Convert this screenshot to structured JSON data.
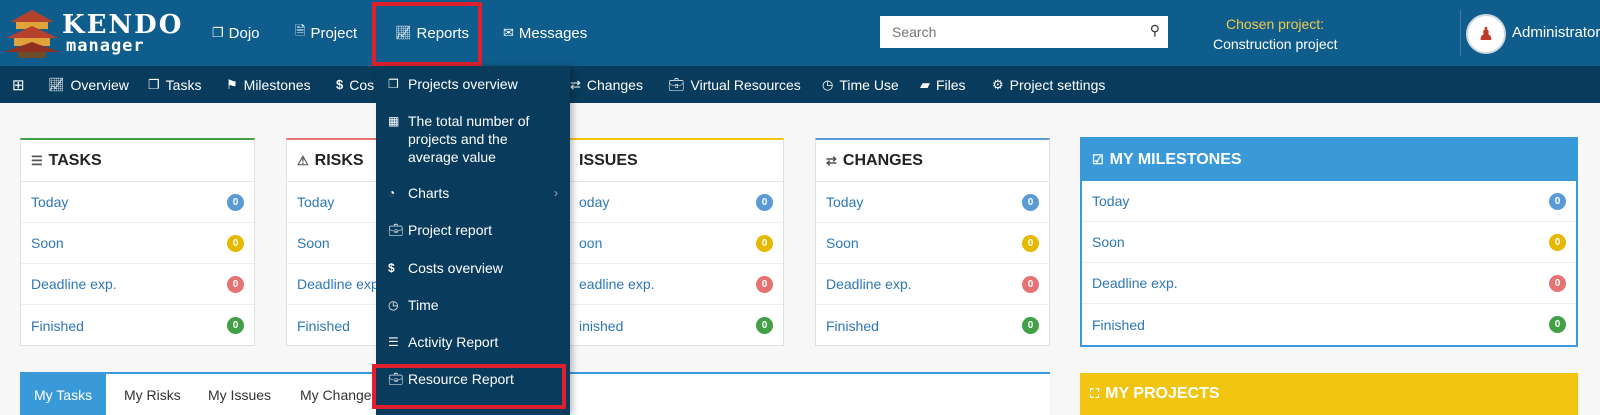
{
  "brand": {
    "line1": "KENDO",
    "line2": "manager"
  },
  "topnav": {
    "items": [
      {
        "icon": "copy-icon",
        "label": "Dojo"
      },
      {
        "icon": "file-icon",
        "label": "Project"
      },
      {
        "icon": "chart-line-icon",
        "label": "Reports"
      },
      {
        "icon": "envelope-icon",
        "label": "Messages"
      }
    ]
  },
  "search": {
    "placeholder": "Search",
    "value": ""
  },
  "chosen_project": {
    "label": "Chosen project:",
    "value": "Construction project"
  },
  "user": {
    "name": "Administrator"
  },
  "subnav": {
    "items": [
      {
        "label": "Overview"
      },
      {
        "label": "Tasks"
      },
      {
        "label": "Milestones"
      },
      {
        "label": "Cos"
      },
      {
        "label": "Changes"
      },
      {
        "label": "Virtual Resources"
      },
      {
        "label": "Time Use"
      },
      {
        "label": "Files"
      },
      {
        "label": "Project settings"
      }
    ]
  },
  "row_labels": [
    "Today",
    "Soon",
    "Deadline exp.",
    "Finished"
  ],
  "cards": {
    "tasks": {
      "title": "TASKS",
      "counts": [
        "0",
        "0",
        "0",
        "0"
      ]
    },
    "risks": {
      "title": "RISKS",
      "rows": [
        "Today",
        "Soon",
        "Deadline exp",
        "Finished"
      ]
    },
    "issues": {
      "title": "ISSUES",
      "rows": [
        "oday",
        "oon",
        "eadline exp.",
        "inished"
      ],
      "counts": [
        "0",
        "0",
        "0",
        "0"
      ]
    },
    "changes": {
      "title": "CHANGES",
      "counts": [
        "0",
        "0",
        "0",
        "0"
      ]
    },
    "milestones": {
      "title": "MY MILESTONES",
      "counts": [
        "0",
        "0",
        "0",
        "0"
      ]
    }
  },
  "projects": {
    "title": "MY PROJECTS"
  },
  "tabs": [
    {
      "label": "My Tasks",
      "active": true
    },
    {
      "label": "My Risks"
    },
    {
      "label": "My Issues"
    },
    {
      "label": "My Change"
    }
  ],
  "reports_menu": {
    "items": [
      {
        "icon": "copy-icon",
        "label": "Projects overview"
      },
      {
        "icon": "calculator-icon",
        "label": "The total number of projects and the average value"
      },
      {
        "icon": "pie-chart-icon",
        "label": "Charts",
        "submenu": true
      },
      {
        "icon": "briefcase-icon",
        "label": "Project report"
      },
      {
        "icon": "dollar-icon",
        "label": "Costs overview"
      },
      {
        "icon": "clock-icon",
        "label": "Time"
      },
      {
        "icon": "list-icon",
        "label": "Activity Report"
      },
      {
        "icon": "briefcase-icon",
        "label": "Resource Report"
      }
    ]
  },
  "colors": {
    "topbar": "#0f5d8c",
    "subnav": "#093c5c",
    "accent": "#3a9ad9",
    "highlight": "#e0202e",
    "projects": "#f1c40f"
  }
}
